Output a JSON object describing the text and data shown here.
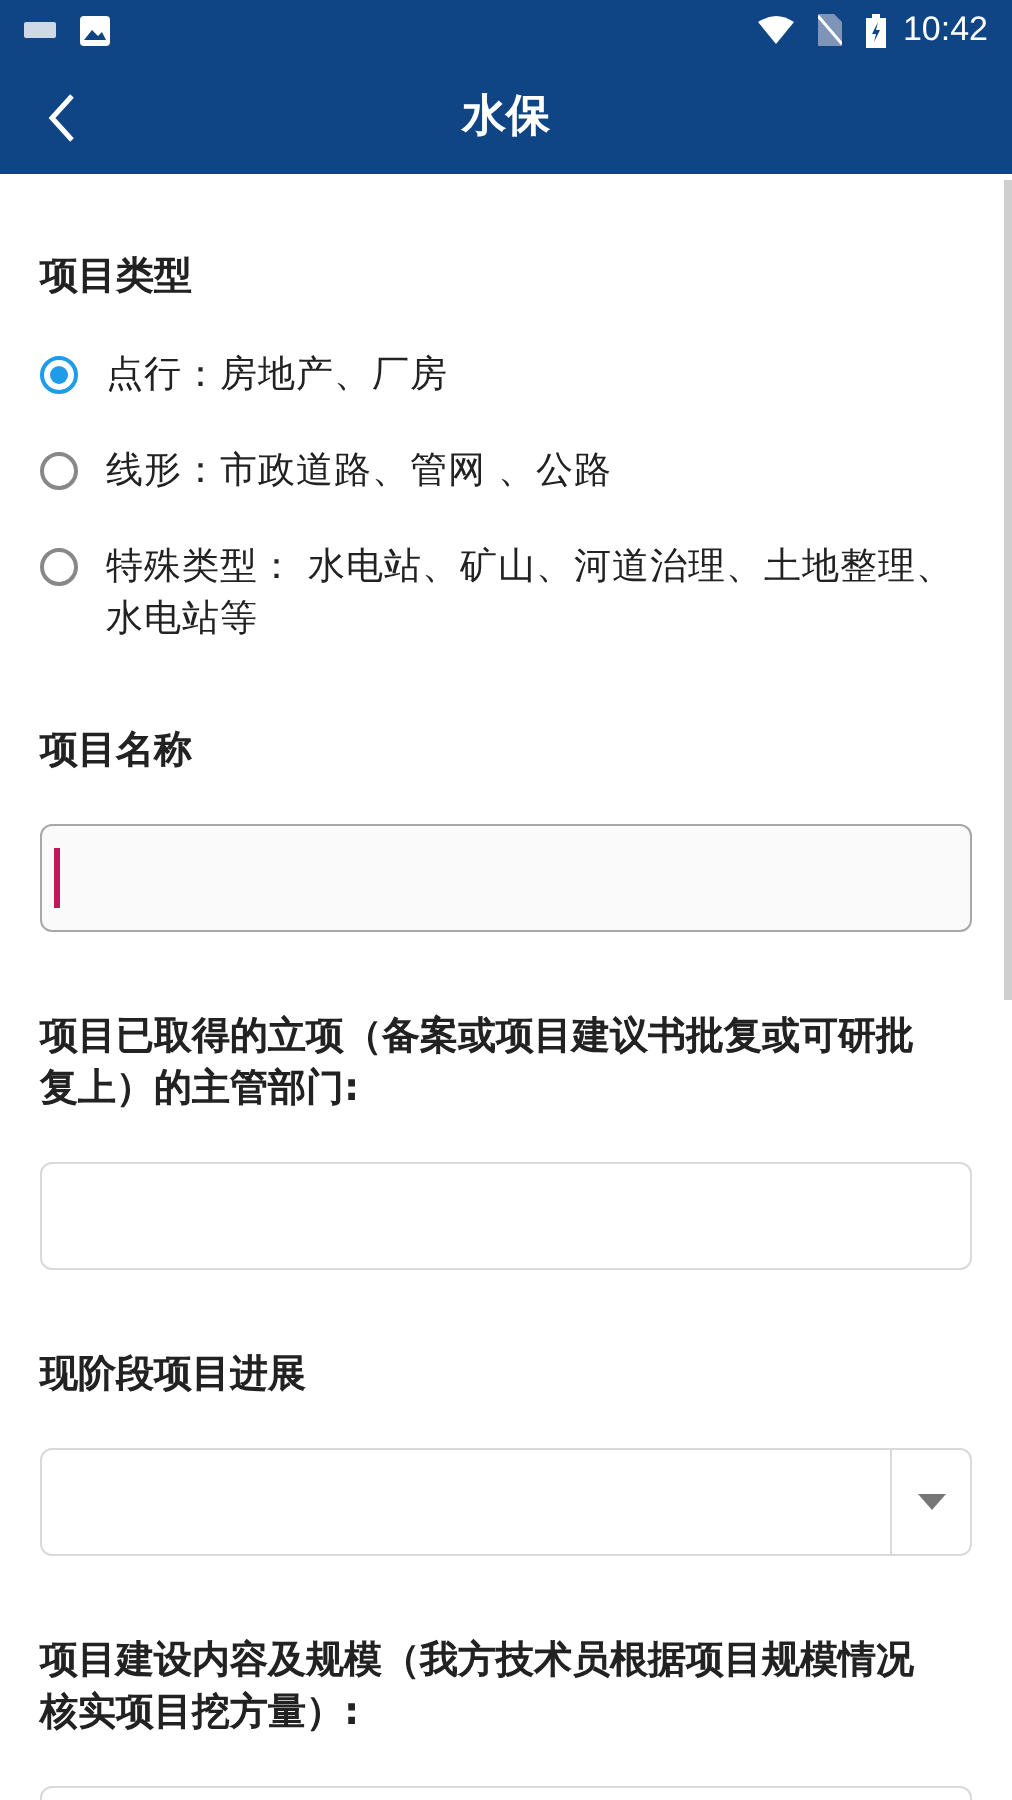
{
  "status_bar": {
    "time": "10:42"
  },
  "app_bar": {
    "title": "水保"
  },
  "sections": [
    {
      "kind": "radio",
      "label": "项目类型",
      "options": [
        {
          "label": "点行：房地产、厂房",
          "selected": true
        },
        {
          "label": "线形：市政道路、管网 、公路",
          "selected": false
        },
        {
          "label": "特殊类型： 水电站、矿山、河道治理、土地整理、水电站等",
          "selected": false
        }
      ]
    },
    {
      "kind": "text",
      "label": "项目名称",
      "focused": true
    },
    {
      "kind": "text",
      "label": "项目已取得的立项（备案或项目建议书批复或可研批复上）的主管部门:",
      "focused": false
    },
    {
      "kind": "select",
      "label": "现阶段项目进展"
    },
    {
      "kind": "text",
      "label": "项目建设内容及规模（我方技术员根据项目规模情况核实项目挖方量）:",
      "focused": false
    }
  ]
}
